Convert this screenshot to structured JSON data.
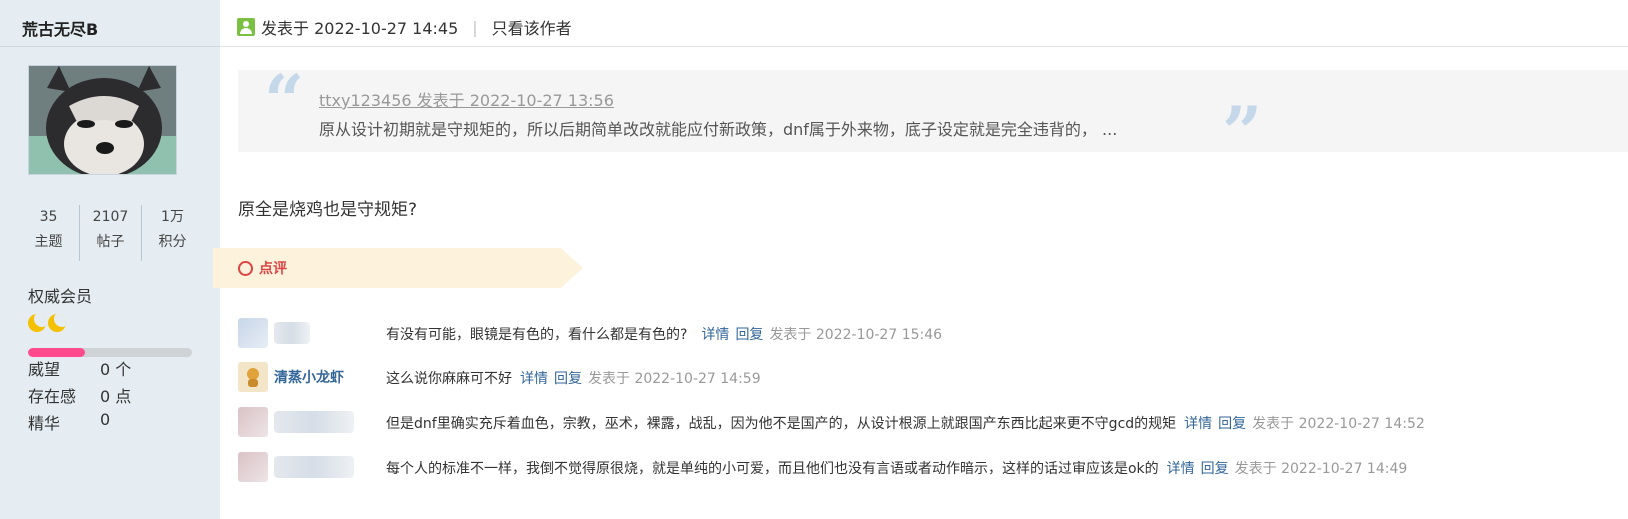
{
  "author": {
    "name": "荒古无尽B",
    "stats": [
      {
        "value": "35",
        "label": "主题"
      },
      {
        "value": "2107",
        "label": "帖子"
      },
      {
        "value": "1万",
        "label": "积分"
      }
    ],
    "usergroup": "权威会员",
    "level_progress_percent": 35,
    "profile": [
      {
        "label": "威望",
        "value": "0 个"
      },
      {
        "label": "存在感",
        "value": "0 点"
      },
      {
        "label": "精华",
        "value": "0"
      }
    ]
  },
  "post": {
    "posted_at": "发表于 2022-10-27 14:45",
    "only_author": "只看该作者",
    "quote": {
      "meta": "ttxy123456 发表于 2022-10-27 13:56",
      "text": "原从设计初期就是守规矩的，所以后期简单改改就能应付新政策，dnf属于外来物，底子设定就是完全违背的， ..."
    },
    "body": "原全是烧鸡也是守规矩?"
  },
  "comments": {
    "title": "点评",
    "items": [
      {
        "user": "",
        "text": "有没有可能，眼镜是有色的，看什么都是有色的?",
        "detail": "详情",
        "reply": "回复",
        "time": "发表于 2022-10-27 15:46"
      },
      {
        "user": "清蒸小龙虾",
        "text": "这么说你麻麻可不好",
        "detail": "详情",
        "reply": "回复",
        "time": "发表于 2022-10-27 14:59"
      },
      {
        "user": "",
        "text": "但是dnf里确实充斥着血色，宗教，巫术，裸露，战乱，因为他不是国产的，从设计根源上就跟国产东西比起来更不守gcd的规矩",
        "detail": "详情",
        "reply": "回复",
        "time": "发表于 2022-10-27 14:52"
      },
      {
        "user": "",
        "text": "每个人的标准不一样，我倒不觉得原很烧，就是单纯的小可爱，而且他们也没有言语或者动作暗示，这样的话过审应该是ok的",
        "detail": "详情",
        "reply": "回复",
        "time": "发表于 2022-10-27 14:49"
      }
    ]
  },
  "colors": {
    "sidebar_bg": "#e5edf2",
    "link": "#336699",
    "comment_accent": "#dd4444",
    "progress_fill": "#ff4a8d"
  }
}
